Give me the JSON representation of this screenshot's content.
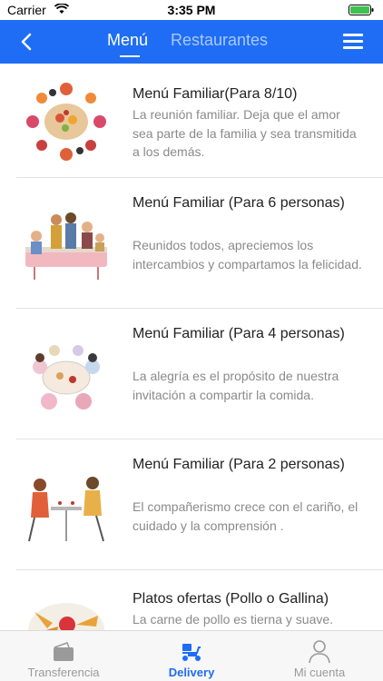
{
  "status_bar": {
    "carrier": "Carrier",
    "time": "3:35 PM"
  },
  "header": {
    "back_icon": "chevron-left-icon",
    "tabs": [
      {
        "label": "Menú",
        "active": true
      },
      {
        "label": "Restaurantes",
        "active": false
      }
    ],
    "menu_icon": "hamburger-icon"
  },
  "menus": [
    {
      "title": "Menú Familiar(Para 8/10)",
      "description": "La reunión familiar. Deja que el amor sea parte de la familia y sea transmitida a los demás."
    },
    {
      "title": "Menú Familiar (Para 6 personas)",
      "description": "Reunidos todos, apreciemos los intercambios y compartamos la felicidad."
    },
    {
      "title": "Menú Familiar (Para 4 personas)",
      "description": "La alegría es el propósito de nuestra invitación a compartir la comida."
    },
    {
      "title": "Menú Familiar (Para 2 personas)",
      "description": "El compañerismo crece con el cariño, el cuidado y la comprensión ."
    },
    {
      "title": "Platos ofertas (Pollo o Gallina)",
      "description": "La carne de pollo es tierna y suave."
    }
  ],
  "tab_bar": [
    {
      "label": "Transferencia",
      "icon": "wallet-icon",
      "active": false
    },
    {
      "label": "Delivery",
      "icon": "scooter-icon",
      "active": true
    },
    {
      "label": "Mi cuenta",
      "icon": "user-icon",
      "active": false
    }
  ],
  "colors": {
    "primary": "#1f6df4",
    "text": "#222222",
    "muted": "#8a8a8a"
  }
}
